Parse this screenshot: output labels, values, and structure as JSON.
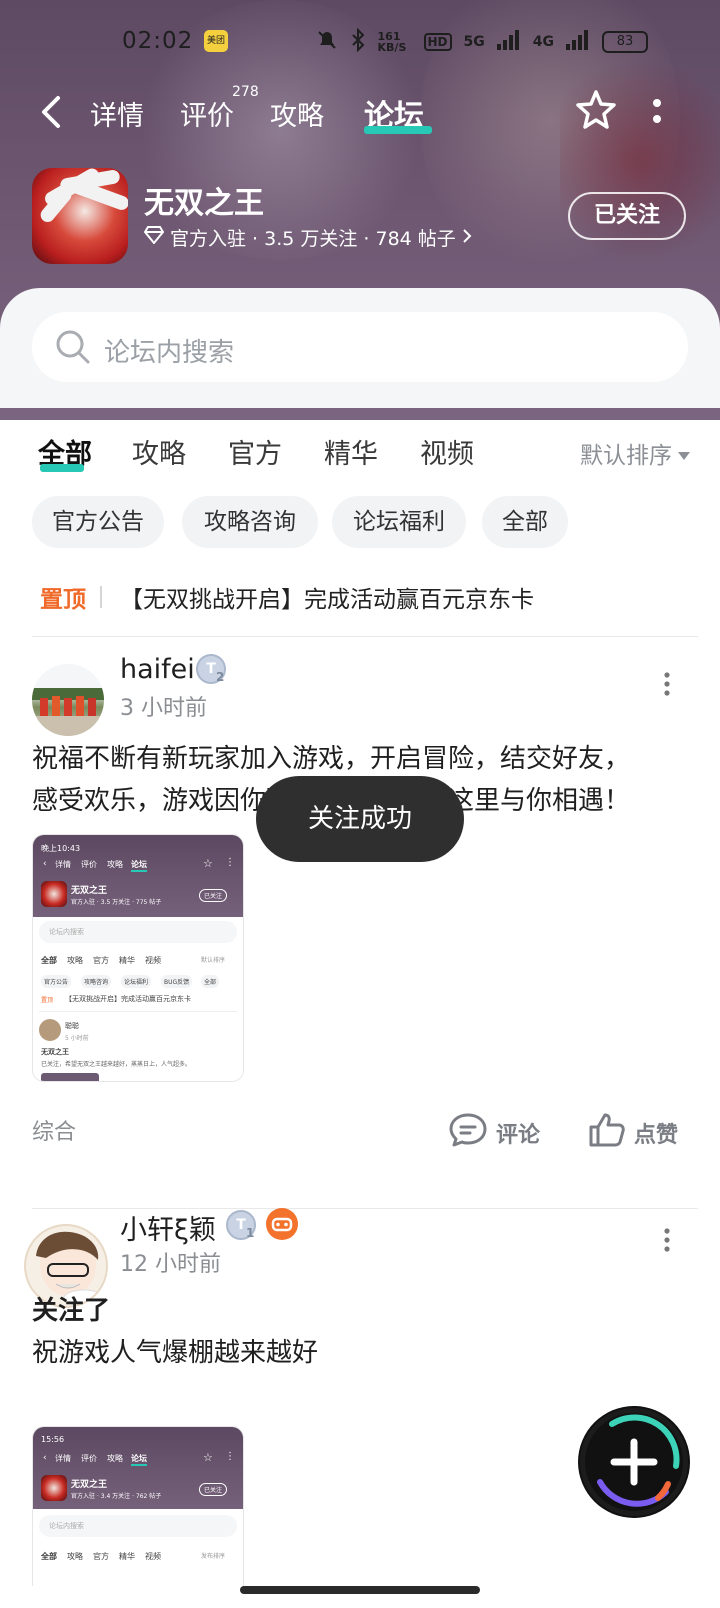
{
  "status_bar": {
    "time": "02:02",
    "app_badge": "美团",
    "net_speed": "161 KB/S",
    "hd": "HD",
    "sig1": "5G",
    "sig2": "4G",
    "battery": "83"
  },
  "nav": {
    "tabs": [
      "详情",
      "评价",
      "攻略",
      "论坛"
    ],
    "review_count": "278",
    "active_tab": "论坛"
  },
  "game": {
    "name": "无双之王",
    "meta": "官方入驻 · 3.5 万关注 · 784 帖子",
    "follow_label": "已关注"
  },
  "search": {
    "placeholder": "论坛内搜索"
  },
  "categories": {
    "tabs": [
      "全部",
      "攻略",
      "官方",
      "精华",
      "视频"
    ],
    "sort_label": "默认排序"
  },
  "chips": [
    "官方公告",
    "攻略咨询",
    "论坛福利",
    "全部"
  ],
  "pinned": {
    "tag": "置顶",
    "text": "【无双挑战开启】完成活动赢百元京东卡"
  },
  "posts": [
    {
      "user": "haifei",
      "level": "2",
      "time": "3 小时前",
      "text": "祝福不断有新玩家加入游戏，开启冒险，结交好友，感受欢乐，游戏因你而精彩，我们在这里与你相遇！",
      "text_line1": "祝福不断有新玩家加入游戏，开启冒险，结交好友，",
      "text_line2": "感受欢乐，游戏因你而精彩，我们在这里与你相遇！",
      "category": "综合",
      "comment_label": "评论",
      "like_label": "点赞",
      "thumb": {
        "tabs": [
          "详情",
          "评价",
          "攻略",
          "论坛"
        ],
        "game": "无双之王",
        "meta": "官方入驻 · 3.5 万关注 · 775 帖子",
        "follow": "已关注",
        "search": "论坛内搜索",
        "cats": [
          "全部",
          "攻略",
          "官方",
          "精华",
          "视频"
        ],
        "sort": "默认排序",
        "chips": [
          "官方公告",
          "攻略咨询",
          "论坛福利",
          "BUG反馈",
          "全部"
        ],
        "pinned_tag": "置顶",
        "pinned": "【无双挑战开启】完成活动赢百元京东卡",
        "user": "聪聪",
        "time": "5 小时前",
        "post_title": "无双之王",
        "post_body": "已关注，希望无双之王越来越好，蒸蒸日上，人气超多。"
      }
    },
    {
      "user": "小轩ξ颖",
      "level": "1",
      "time": "12 小时前",
      "title": "关注了",
      "text": "祝游戏人气爆棚越来越好",
      "thumb": {
        "tabs": [
          "详情",
          "评价",
          "攻略",
          "论坛"
        ],
        "game": "无双之王",
        "meta": "官方入驻 · 3.4 万关注 · 762 帖子",
        "follow": "已关注",
        "search": "论坛内搜索",
        "cats": [
          "全部",
          "攻略",
          "官方",
          "精华",
          "视频"
        ],
        "sort": "发布排序",
        "time": "15:56"
      }
    }
  ],
  "toast": "关注成功",
  "colors": {
    "accent": "#28c8b6",
    "pinned": "#f06a2a",
    "hero": "#6d5670"
  },
  "icons": [
    "back-icon",
    "star-icon",
    "more-icon",
    "diamond-icon",
    "search-icon",
    "comment-icon",
    "like-icon",
    "plus-icon",
    "level-icon"
  ]
}
